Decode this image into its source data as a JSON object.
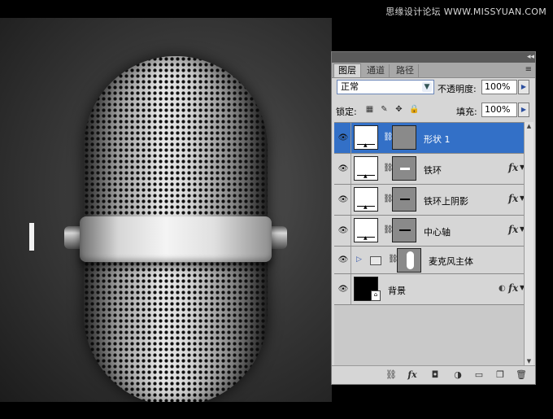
{
  "watermark": "思缘设计论坛 WWW.MISSYUAN.COM",
  "panel": {
    "window_controls": [
      "◂◂",
      "✕"
    ],
    "tabs": [
      {
        "label": "图层",
        "active": true
      },
      {
        "label": "通道",
        "active": false
      },
      {
        "label": "路径",
        "active": false
      }
    ],
    "blend_mode": "正常",
    "opacity_label": "不透明度:",
    "opacity_value": "100%",
    "lock_label": "锁定:",
    "fill_label": "填充:",
    "fill_value": "100%",
    "layers": [
      {
        "name": "形状 1",
        "selected": true,
        "fx": false
      },
      {
        "name": "铁环",
        "selected": false,
        "fx": true
      },
      {
        "name": "铁环上阴影",
        "selected": false,
        "fx": true
      },
      {
        "name": "中心轴",
        "selected": false,
        "fx": true
      },
      {
        "name": "麦克风主体",
        "selected": false,
        "fx": false,
        "group": true
      },
      {
        "name": "背景",
        "selected": false,
        "fx": true,
        "locked": true
      }
    ],
    "fx_label": "fx",
    "bottom_icons": [
      "link-icon",
      "fx-icon",
      "mask-icon",
      "adjustment-icon",
      "folder-icon",
      "new-layer-icon",
      "trash-icon"
    ]
  },
  "colors": {
    "selection": "#3370c7",
    "panel_bg": "#d6d6d6"
  }
}
